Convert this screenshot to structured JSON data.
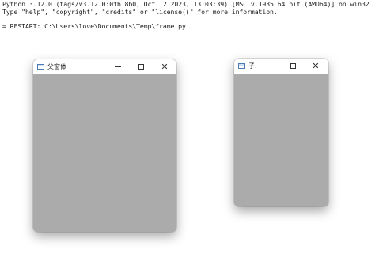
{
  "shell": {
    "lines": [
      "Python 3.12.0 (tags/v3.12.0:0fb18b0, Oct  2 2023, 13:03:39) [MSC v.1935 64 bit (AMD64)] on win32",
      "Type \"help\", \"copyright\", \"credits\" or \"license()\" for more information.",
      "",
      "= RESTART: C:\\Users\\love\\Documents\\Temp\\frame.py"
    ]
  },
  "windows": {
    "parent": {
      "title": "父窗体",
      "icon": "window-app-icon",
      "controls": {
        "minimize": "—",
        "maximize": "□",
        "close": "✕"
      }
    },
    "child": {
      "title": "子.",
      "icon": "window-app-icon",
      "controls": {
        "minimize": "—",
        "maximize": "□",
        "close": "✕"
      }
    }
  },
  "colors": {
    "client_area": "#ababab",
    "titlebar": "#ffffff",
    "background": "#ffffff"
  }
}
